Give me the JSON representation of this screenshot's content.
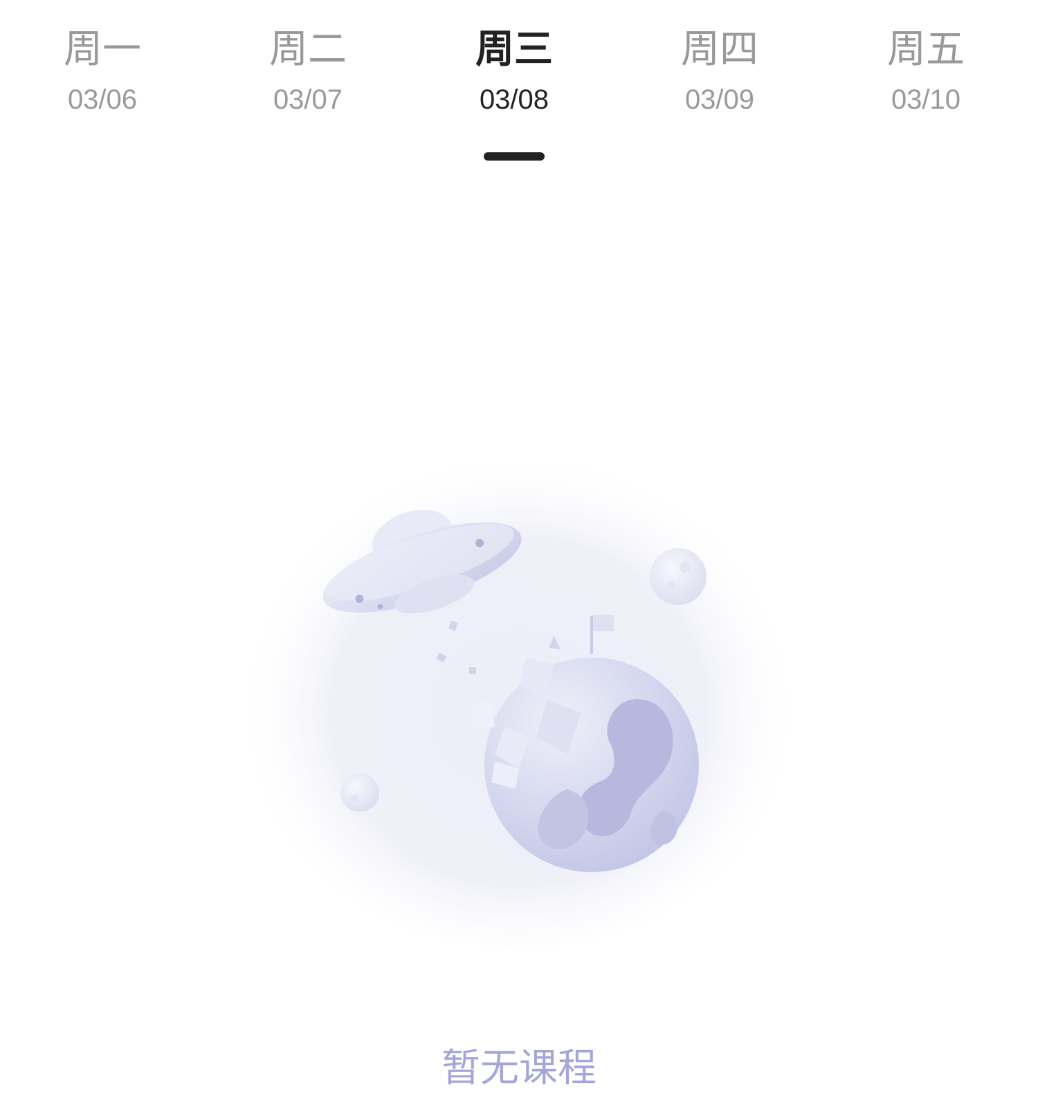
{
  "week_tabs": [
    {
      "day": "周一",
      "date": "03/06",
      "active": false
    },
    {
      "day": "周二",
      "date": "03/07",
      "active": false
    },
    {
      "day": "周三",
      "date": "03/08",
      "active": true
    },
    {
      "day": "周四",
      "date": "03/09",
      "active": false
    },
    {
      "day": "周五",
      "date": "03/10",
      "active": false
    }
  ],
  "empty_state": {
    "message": "暂无课程",
    "illustration": "ufo-and-broken-planet-illustration"
  },
  "colors": {
    "active_text": "#222222",
    "inactive_text": "#999999",
    "empty_text": "#a3a6d6",
    "illustration_tint": "#c9cce8"
  }
}
